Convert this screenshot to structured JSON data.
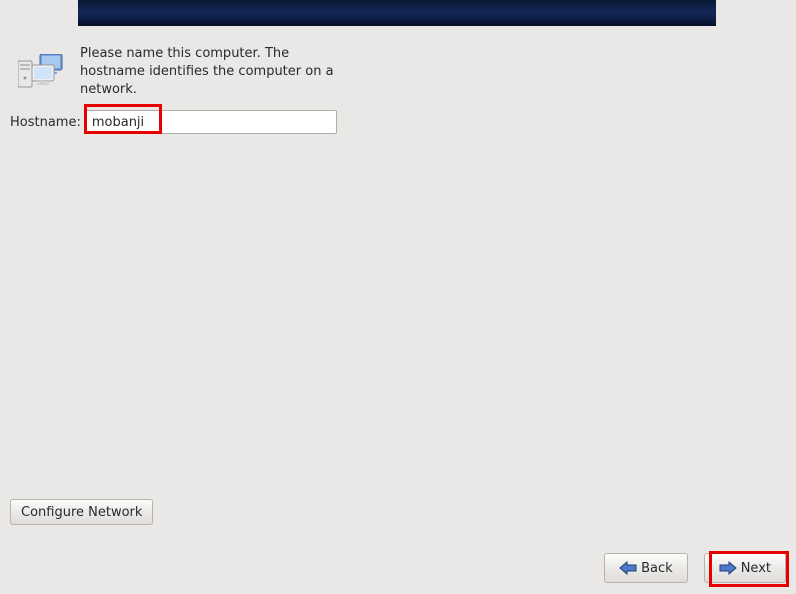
{
  "instruction": "Please name this computer.  The hostname identifies the computer on a network.",
  "hostname": {
    "label": "Hostname:",
    "value": "mobanji"
  },
  "buttons": {
    "configure_network": "Configure Network",
    "back": "Back",
    "next": "Next"
  },
  "colors": {
    "highlight": "#e60000",
    "banner": "#14275a"
  }
}
